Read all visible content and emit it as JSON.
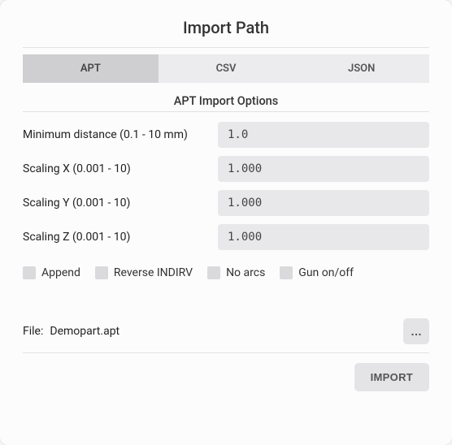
{
  "title": "Import Path",
  "tabs": {
    "apt": "APT",
    "csv": "CSV",
    "json": "JSON"
  },
  "section_heading": "APT Import Options",
  "options": {
    "min_distance": {
      "label": "Minimum distance (0.1 - 10 mm)",
      "value": "1.0"
    },
    "scaling_x": {
      "label": "Scaling X (0.001 - 10)",
      "value": "1.000"
    },
    "scaling_y": {
      "label": "Scaling Y (0.001 - 10)",
      "value": "1.000"
    },
    "scaling_z": {
      "label": "Scaling Z (0.001 - 10)",
      "value": "1.000"
    }
  },
  "checkboxes": {
    "append": "Append",
    "reverse_indirv": "Reverse INDIRV",
    "no_arcs": "No arcs",
    "gun_onoff": "Gun on/off"
  },
  "file": {
    "label": "File:",
    "name": "Demopart.apt",
    "browse": "…"
  },
  "import_button": "IMPORT"
}
